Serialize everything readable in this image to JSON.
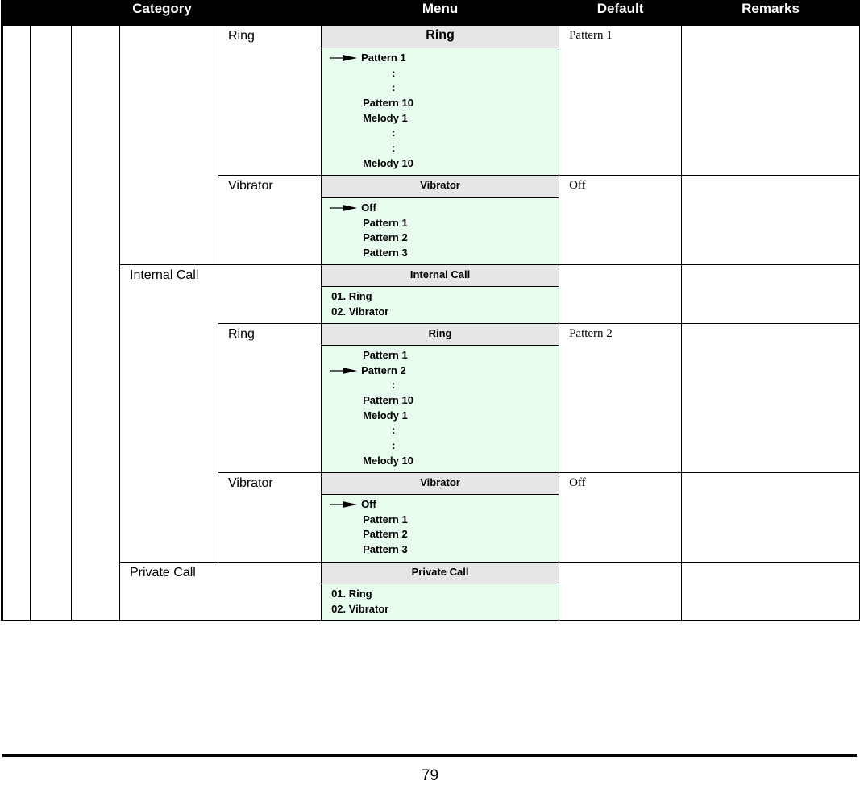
{
  "header": {
    "category": "Category",
    "menu": "Menu",
    "default": "Default",
    "remarks": "Remarks"
  },
  "rows": [
    {
      "label": "Ring",
      "menu_title": "Ring",
      "default": "Pattern 1",
      "items": [
        {
          "text": "Pattern 1",
          "selected": true
        },
        {
          "text": ":"
        },
        {
          "text": ":"
        },
        {
          "text": "Pattern 10"
        },
        {
          "text": "Melody 1"
        },
        {
          "text": ":"
        },
        {
          "text": ":"
        },
        {
          "text": "Melody 10"
        }
      ]
    },
    {
      "label": "Vibrator",
      "menu_title": "Vibrator",
      "default": "Off",
      "items": [
        {
          "text": "Off",
          "selected": true
        },
        {
          "text": "Pattern 1"
        },
        {
          "text": "Pattern 2"
        },
        {
          "text": "Pattern 3"
        }
      ]
    },
    {
      "label": "Internal Call",
      "menu_title": "Internal Call",
      "default": "",
      "items": [
        {
          "text": "01. Ring"
        },
        {
          "text": "02. Vibrator"
        }
      ]
    },
    {
      "label": "Ring",
      "menu_title": "Ring",
      "default": "Pattern 2",
      "items": [
        {
          "text": "Pattern 1"
        },
        {
          "text": "Pattern 2",
          "selected": true
        },
        {
          "text": ":"
        },
        {
          "text": "Pattern 10"
        },
        {
          "text": "Melody 1"
        },
        {
          "text": ":"
        },
        {
          "text": ":"
        },
        {
          "text": "Melody 10"
        }
      ]
    },
    {
      "label": "Vibrator",
      "menu_title": "Vibrator",
      "default": "Off",
      "items": [
        {
          "text": "Off",
          "selected": true
        },
        {
          "text": "Pattern 1"
        },
        {
          "text": "Pattern 2"
        },
        {
          "text": "Pattern 3"
        }
      ]
    },
    {
      "label": "Private Call",
      "menu_title": "Private Call",
      "default": "",
      "items": [
        {
          "text": "01. Ring"
        },
        {
          "text": "02. Vibrator"
        }
      ]
    }
  ],
  "page_number": "79",
  "colors": {
    "menu_header": "#e6e6e6",
    "menu_body": "#e8fcee"
  },
  "icons": {
    "selected": "arrow-right-icon"
  }
}
